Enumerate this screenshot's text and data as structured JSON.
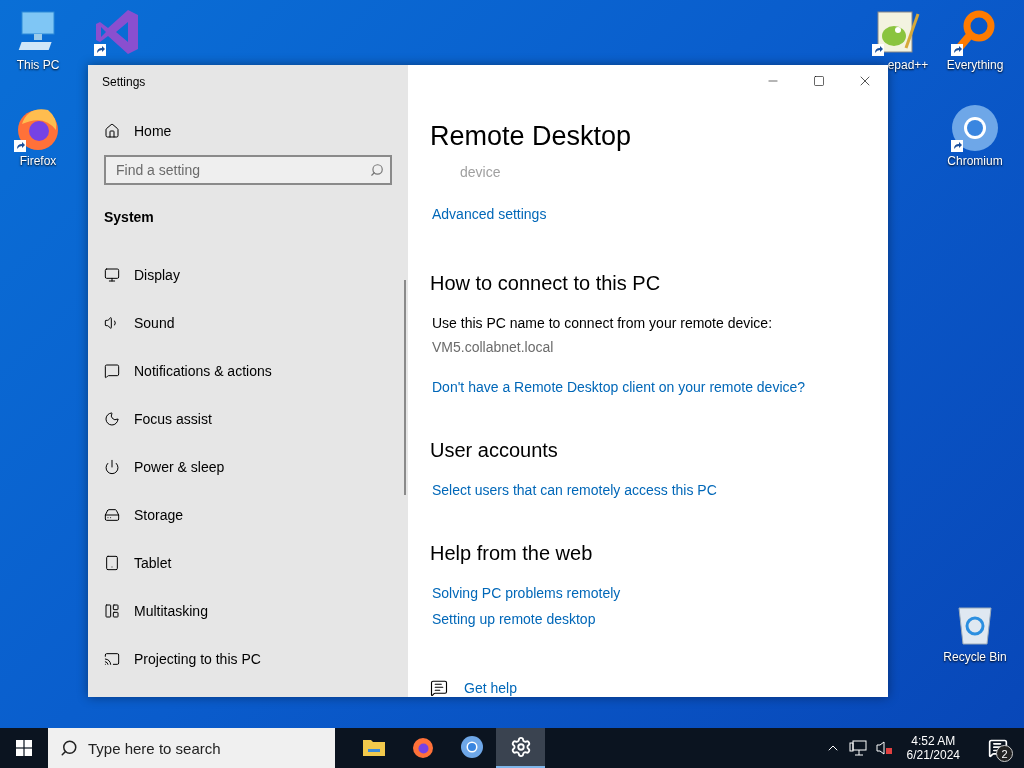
{
  "desktop": {
    "icons": [
      {
        "kind": "pc",
        "label": "This PC",
        "shortcut": false
      },
      {
        "kind": "vs",
        "shortcut": true
      },
      {
        "kind": "firefox",
        "label": "Firefox",
        "shortcut": true
      },
      {
        "kind": "notepad",
        "label": "epad++",
        "shortcut": true
      },
      {
        "kind": "everything",
        "label": "Everything",
        "shortcut": true
      },
      {
        "kind": "chromium",
        "label": "Chromium",
        "shortcut": true
      },
      {
        "kind": "recycle",
        "label": "Recycle Bin",
        "shortcut": false
      }
    ]
  },
  "window": {
    "title": "Settings",
    "sidebar": {
      "home": "Home",
      "search": {
        "placeholder": "Find a setting"
      },
      "group": "System",
      "items": [
        {
          "kind": "display",
          "label": "Display"
        },
        {
          "kind": "sound",
          "label": "Sound"
        },
        {
          "kind": "notifications",
          "label": "Notifications & actions"
        },
        {
          "kind": "focus",
          "label": "Focus assist"
        },
        {
          "kind": "power",
          "label": "Power & sleep"
        },
        {
          "kind": "storage",
          "label": "Storage"
        },
        {
          "kind": "tablet",
          "label": "Tablet"
        },
        {
          "kind": "multitasking",
          "label": "Multitasking"
        },
        {
          "kind": "projecting",
          "label": "Projecting to this PC"
        }
      ]
    },
    "content": {
      "title": "Remote Desktop",
      "faded_text": "device",
      "top_link": "Advanced settings",
      "sections": [
        {
          "heading": "How to connect to this PC",
          "items": [
            {
              "kind": "text",
              "text": "Use this PC name to connect from your remote device:"
            },
            {
              "kind": "value",
              "text": "VM5.collabnet.local"
            },
            {
              "kind": "link",
              "text": "Don't have a Remote Desktop client on your remote device?"
            }
          ]
        },
        {
          "heading": "User accounts",
          "items": [
            {
              "kind": "link",
              "text": "Select users that can remotely access this PC"
            }
          ]
        },
        {
          "heading": "Help from the web",
          "items": [
            {
              "kind": "link",
              "text": "Solving PC problems remotely"
            },
            {
              "kind": "link",
              "text": "Setting up remote desktop"
            }
          ]
        }
      ],
      "get_help": "Get help"
    }
  },
  "taskbar": {
    "search": {
      "placeholder": "Type here to search"
    },
    "apps": [
      {
        "kind": "explorer",
        "selected": false
      },
      {
        "kind": "firefox",
        "selected": false
      },
      {
        "kind": "chromium",
        "selected": false
      },
      {
        "kind": "settings",
        "selected": true
      }
    ],
    "time": "4:52 AM",
    "date": "6/21/2024",
    "notification_count": "2"
  }
}
